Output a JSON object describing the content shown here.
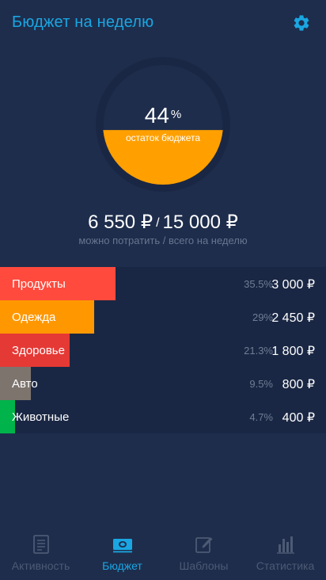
{
  "header": {
    "title": "Бюджет на неделю",
    "settings_icon": "gear-icon"
  },
  "gauge": {
    "percent_value": "44",
    "percent_symbol": "%",
    "label": "остаток бюджета",
    "fill_fraction": 0.44,
    "fill_color": "#ffa000",
    "ring_color": "#1a2744"
  },
  "budget": {
    "remaining": "6 550 ₽",
    "separator": "/",
    "total": "15 000 ₽",
    "caption": "можно потратить / всего на неделю"
  },
  "categories": [
    {
      "name": "Продукты",
      "percent": "35.5%",
      "amount": "3 000 ₽",
      "share": 0.355,
      "color": "#ff4a3d"
    },
    {
      "name": "Одежда",
      "percent": "29%",
      "amount": "2 450 ₽",
      "share": 0.29,
      "color": "#ff9800"
    },
    {
      "name": "Здоровье",
      "percent": "21.3%",
      "amount": "1 800 ₽",
      "share": 0.213,
      "color": "#e53935"
    },
    {
      "name": "Авто",
      "percent": "9.5%",
      "amount": "800 ₽",
      "share": 0.095,
      "color": "#7d746e"
    },
    {
      "name": "Животные",
      "percent": "4.7%",
      "amount": "400 ₽",
      "share": 0.047,
      "color": "#00b34a"
    }
  ],
  "tabs": [
    {
      "label": "Активность",
      "icon": "document-icon",
      "active": false
    },
    {
      "label": "Бюджет",
      "icon": "money-icon",
      "active": true
    },
    {
      "label": "Шаблоны",
      "icon": "edit-icon",
      "active": false
    },
    {
      "label": "Статистика",
      "icon": "bar-chart-icon",
      "active": false
    }
  ],
  "colors": {
    "background": "#1e2d4c",
    "accent": "#1aa6e2",
    "muted": "#4c5a74"
  }
}
